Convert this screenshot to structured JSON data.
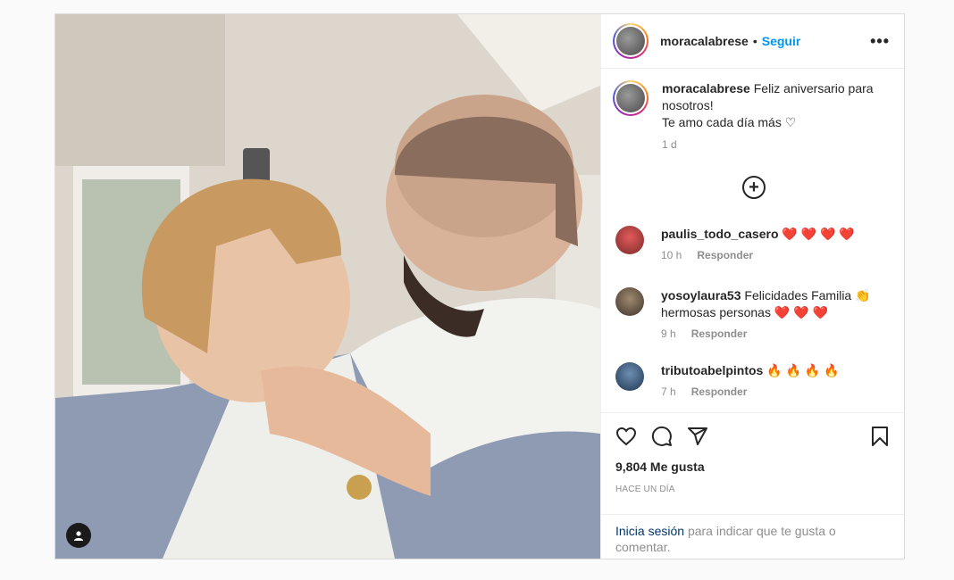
{
  "post": {
    "username": "moracalabrese",
    "separator": "•",
    "follow_label": "Seguir",
    "more_label": "•••",
    "caption_line1": "Feliz aniversario para nosotros!",
    "caption_line2": "Te amo cada día más ♡",
    "caption_time": "1 d",
    "load_more_label": "+"
  },
  "comments": [
    {
      "username": "paulis_todo_casero",
      "text": "❤️ ❤️ ❤️ ❤️",
      "time": "10 h",
      "reply": "Responder"
    },
    {
      "username": "yosoylaura53",
      "text": "Felicidades Familia 👏 hermosas personas ❤️ ❤️ ❤️",
      "time": "9 h",
      "reply": "Responder"
    },
    {
      "username": "tributoabelpintos",
      "text": "🔥 🔥 🔥 🔥",
      "time": "7 h",
      "reply": "Responder"
    }
  ],
  "actions": {
    "icons": [
      "heart-icon",
      "comment-icon",
      "share-icon",
      "bookmark-icon"
    ],
    "likes": "9,804 Me gusta",
    "posted": "HACE UN DÍA"
  },
  "login_prompt": {
    "link": "Inicia sesión",
    "text": "para indicar que te gusta o comentar."
  }
}
